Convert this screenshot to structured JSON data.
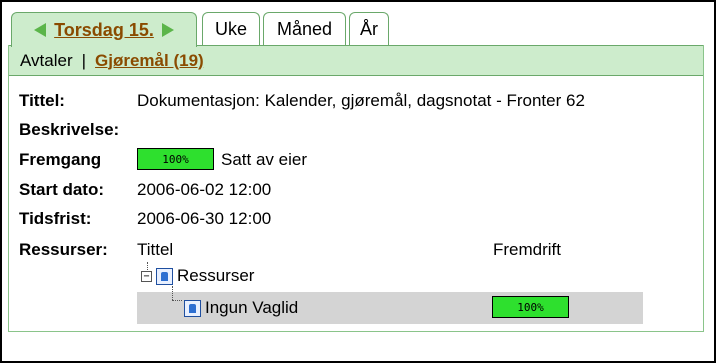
{
  "tabs": {
    "day_label": "Torsdag 15.",
    "week_label": "Uke",
    "month_label": "Måned",
    "year_label": "År"
  },
  "subnav": {
    "appointments": "Avtaler",
    "separator": "|",
    "todos": "Gjøremål (19)"
  },
  "task": {
    "title_label": "Tittel:",
    "title_value": "Dokumentasjon: Kalender, gjøremål, dagsnotat - Fronter 62",
    "description_label": "Beskrivelse:",
    "progress_label": "Fremgang",
    "progress_value": "100%",
    "progress_fraction": 1.0,
    "progress_note": "Satt av eier",
    "start_label": "Start dato:",
    "start_value": "2006-06-02 12:00",
    "deadline_label": "Tidsfrist:",
    "deadline_value": "2006-06-30 12:00"
  },
  "resources": {
    "label": "Ressurser:",
    "col_title": "Tittel",
    "col_progress": "Fremdrift",
    "group_name": "Ressurser",
    "group_expander": "−",
    "items": [
      {
        "name": "Ingun Vaglid",
        "progress": "100%",
        "progress_fraction": 1.0
      }
    ]
  },
  "colors": {
    "accent_green": "#cdeccc",
    "border_green": "#6aa86a",
    "progress_green": "#2ee02e",
    "link_brown": "#8a4b00"
  },
  "icons": {
    "prev": "arrow-left-icon",
    "next": "arrow-right-icon",
    "group": "group-icon",
    "person": "person-icon"
  }
}
